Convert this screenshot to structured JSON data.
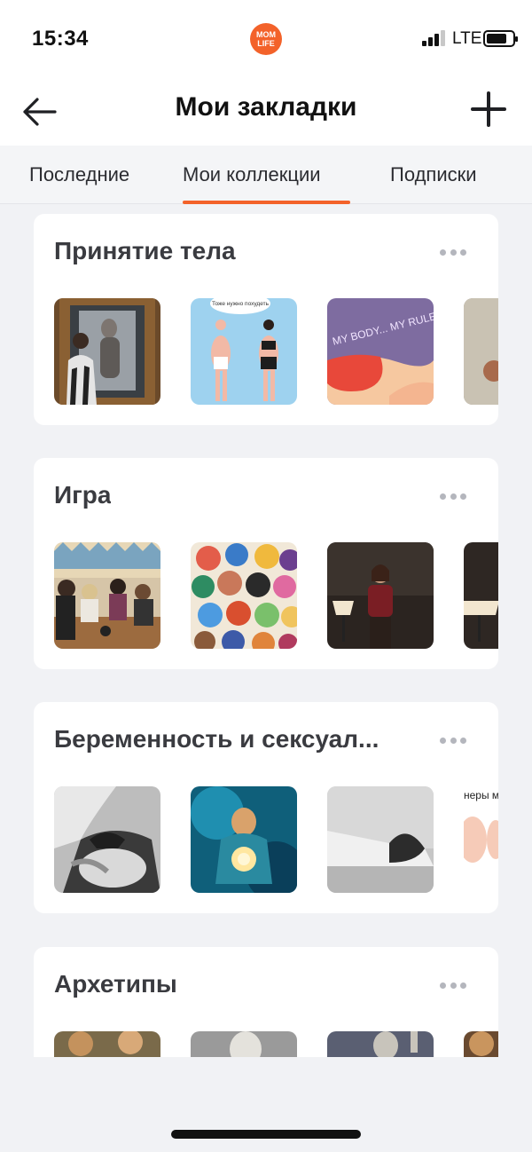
{
  "status_bar": {
    "time": "15:34",
    "network": "LTE",
    "logo_top": "MOM",
    "logo_bottom": "LIFE"
  },
  "header": {
    "title": "Мои закладки"
  },
  "tabs": [
    {
      "label": "Последние",
      "active": false
    },
    {
      "label": "Мои коллекции",
      "active": true
    },
    {
      "label": "Подписки",
      "active": false
    }
  ],
  "collections": [
    {
      "title": "Принятие тела",
      "thumbs": [
        "photo-gallery",
        "illustration-bodies",
        "my-body-my-rules",
        "photo-mirror-partial"
      ],
      "thumb_texts": [
        "Тоже нужно похудеть",
        "MY BODY... MY RULES"
      ]
    },
    {
      "title": "Игра",
      "thumbs": [
        "photo-group-cafe",
        "illustration-crowd",
        "photo-woman-lamp",
        "photo-lamp-partial"
      ]
    },
    {
      "title": "Беременность и сексуал...",
      "thumbs": [
        "photo-pregnant-bw",
        "painting-cosmic-mother",
        "photo-reclining-bw",
        "diagram-partial"
      ],
      "thumb_texts": [
        "неры м"
      ]
    },
    {
      "title": "Архетипы",
      "thumbs": [
        "painting-renaissance",
        "sculpture-bust",
        "sculpture-statue",
        "painting-partial"
      ]
    }
  ],
  "colors": {
    "accent": "#f3622a",
    "background": "#f1f2f5",
    "card": "#ffffff"
  }
}
